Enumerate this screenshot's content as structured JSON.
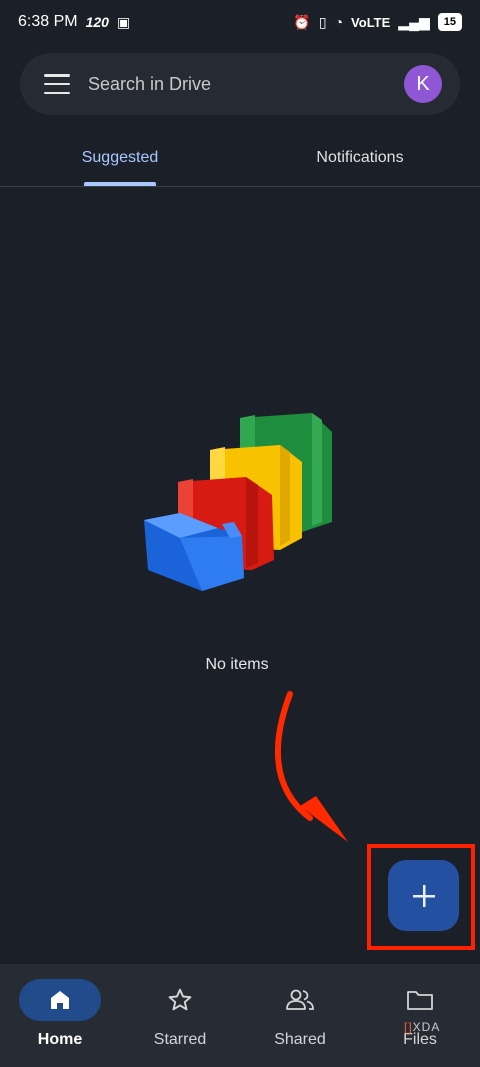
{
  "status_bar": {
    "time": "6:38 PM",
    "refresh_rate": "120",
    "network": "VoLTE",
    "battery": "15"
  },
  "search": {
    "placeholder": "Search in Drive",
    "avatar_letter": "K"
  },
  "tabs": [
    {
      "label": "Suggested",
      "active": true
    },
    {
      "label": "Notifications",
      "active": false
    }
  ],
  "empty_state": {
    "message": "No items"
  },
  "fab": {
    "icon": "plus-icon"
  },
  "bottom_nav": [
    {
      "label": "Home",
      "icon": "home-icon",
      "active": true
    },
    {
      "label": "Starred",
      "icon": "star-icon",
      "active": false
    },
    {
      "label": "Shared",
      "icon": "people-icon",
      "active": false
    },
    {
      "label": "Files",
      "icon": "folder-icon",
      "active": false
    }
  ],
  "watermark": "XDA",
  "colors": {
    "background": "#1b1f27",
    "accent": "#a9c7ff",
    "fab": "#2350a0",
    "highlight": "#ff2200",
    "avatar": "#8f56d6"
  }
}
